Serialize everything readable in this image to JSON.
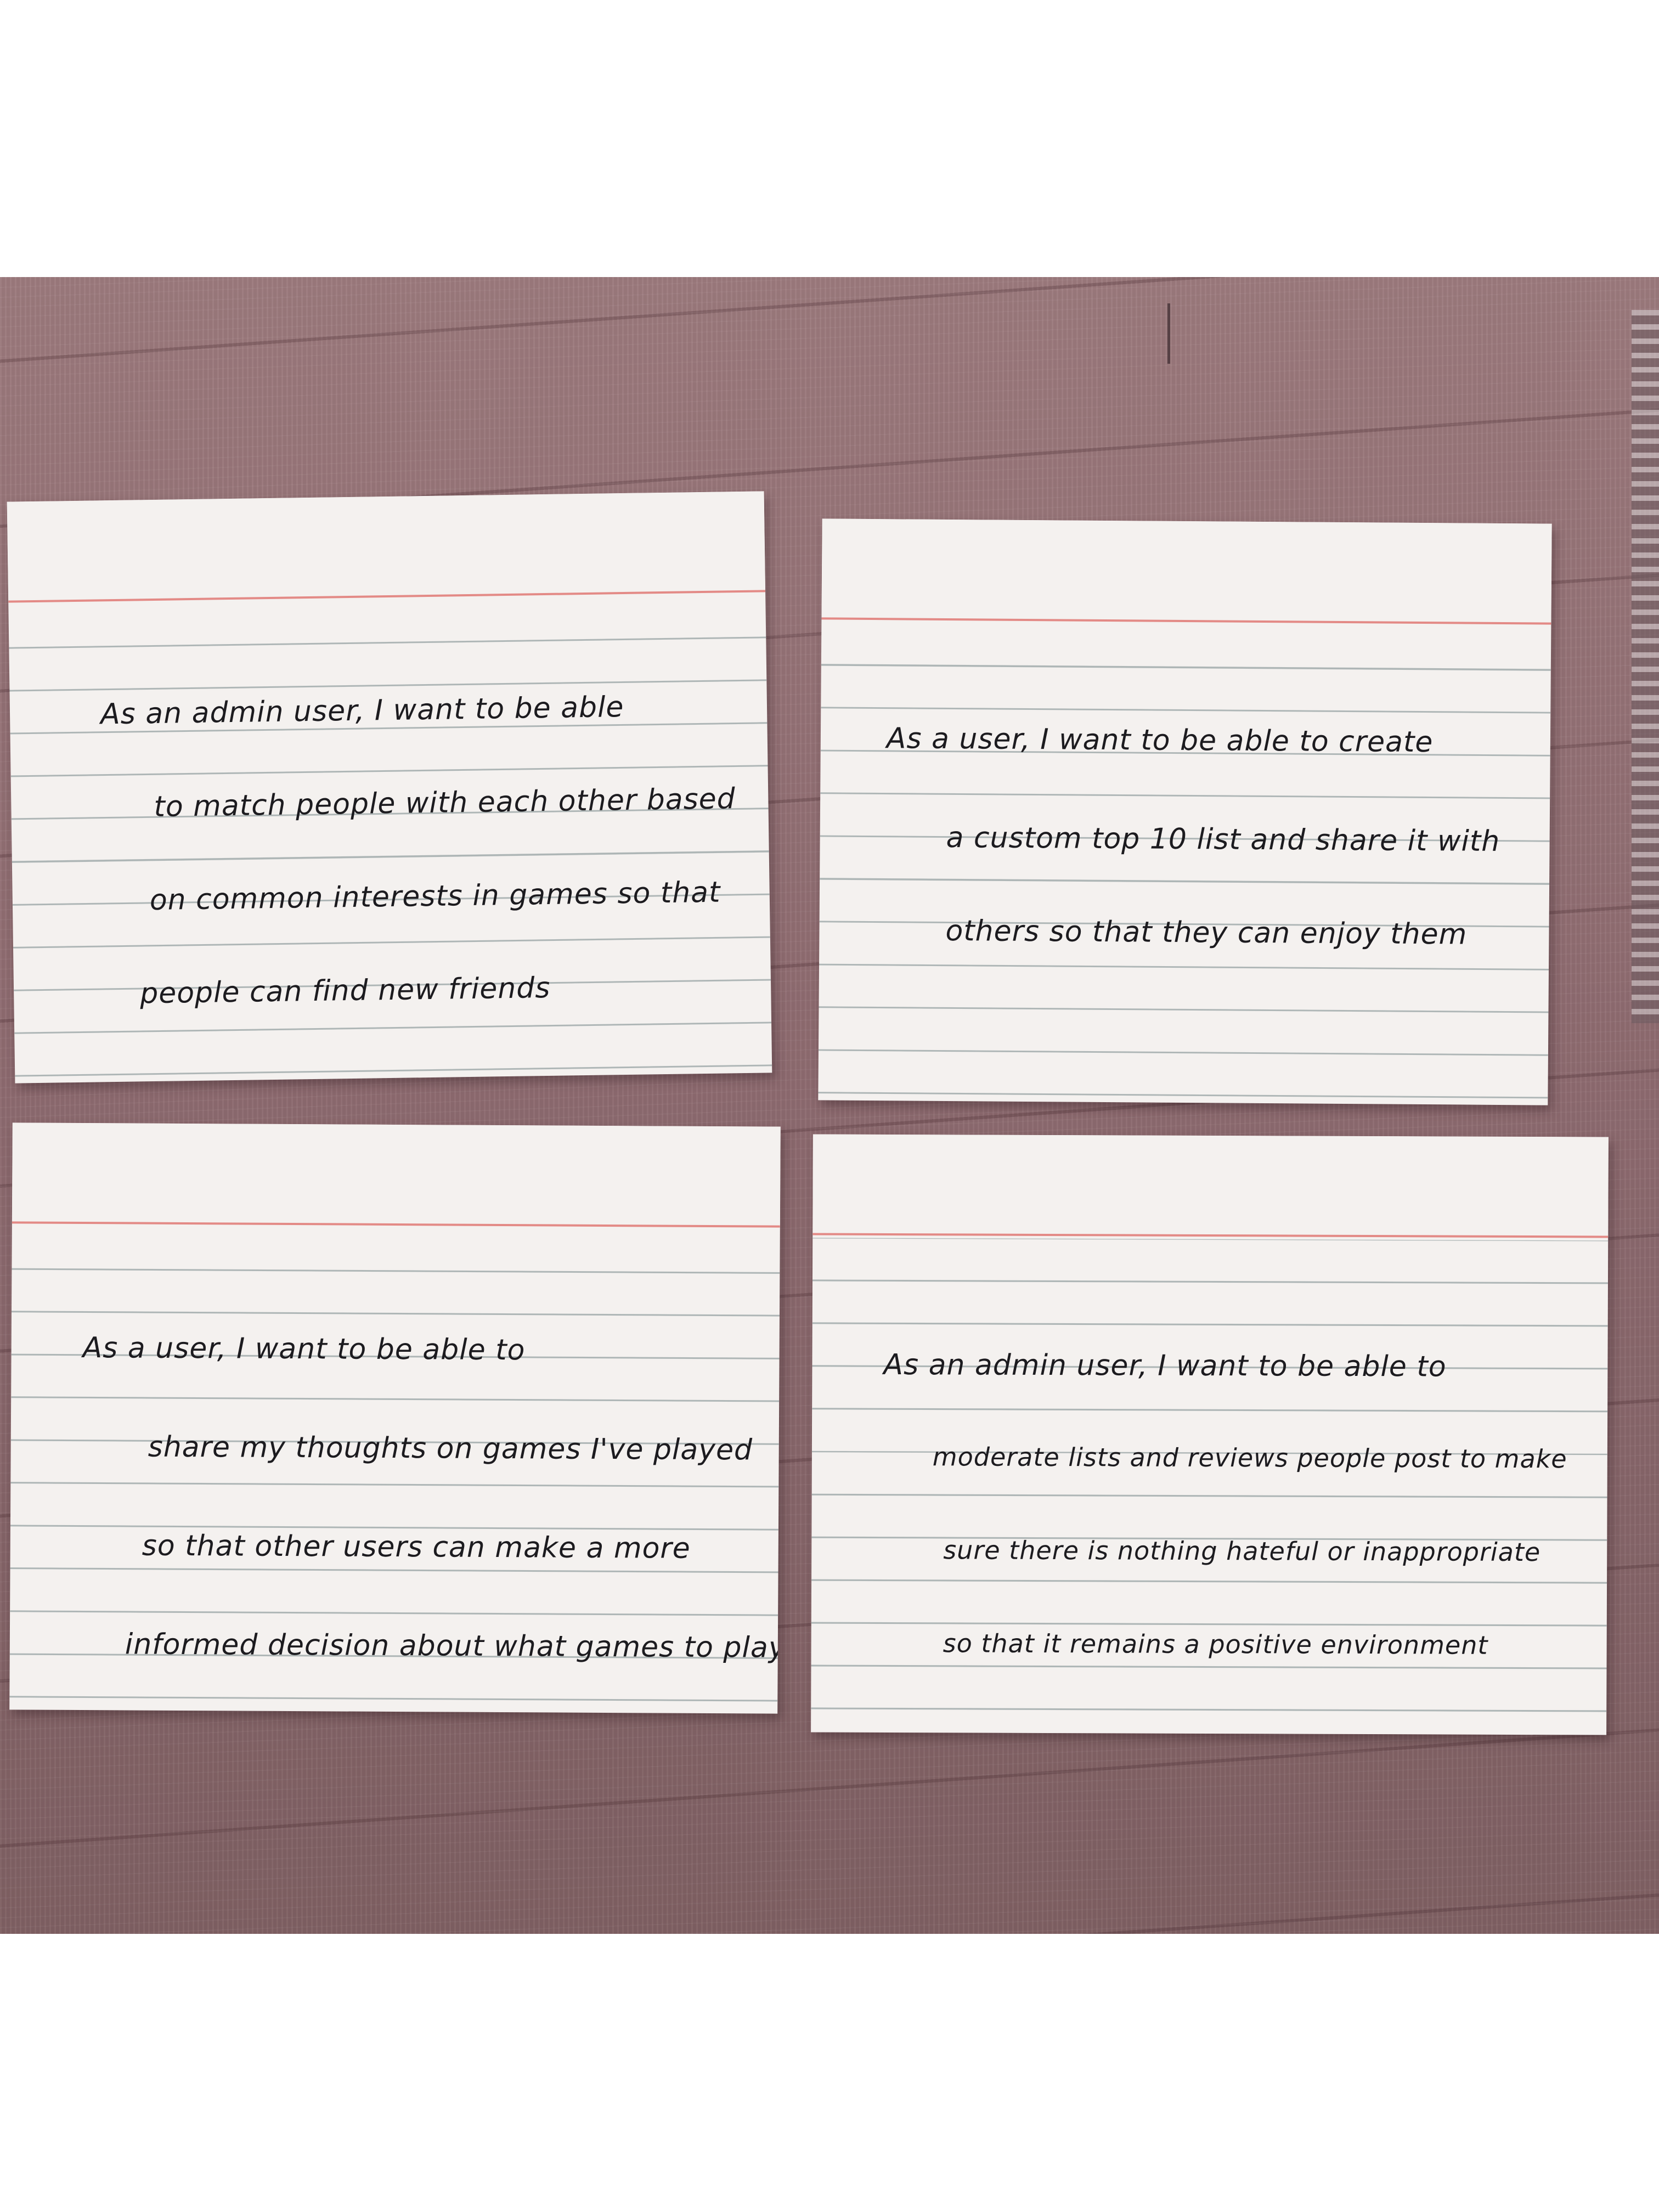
{
  "cards": [
    {
      "lines": [
        "As an admin user, I want to be able",
        "to match people with each other based",
        "on common interests in games so that",
        "people can find new friends"
      ]
    },
    {
      "lines": [
        "As a user, I want to be able to create",
        "a custom top 10 list and share it with",
        "others so that they can enjoy them"
      ]
    },
    {
      "lines": [
        "As a user, I want to be able to",
        "share my thoughts on games I've played",
        "so that other users can make a more",
        "informed decision about what games to play"
      ]
    },
    {
      "lines": [
        "As an admin user, I want to be able to",
        "moderate lists and reviews people post to make",
        "sure there is nothing hateful or inappropriate",
        "so that it remains a positive environment"
      ]
    }
  ],
  "colors": {
    "table": "#8e6b70",
    "card": "#f4f1ef",
    "red_rule": "#e38a86",
    "blue_rule": "#aeb6b6",
    "ink": "#1c1b1f"
  }
}
